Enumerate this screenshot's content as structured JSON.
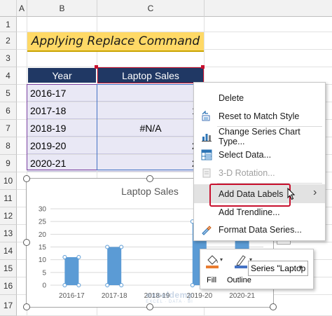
{
  "sheet": {
    "columns": [
      "A",
      "B",
      "C"
    ],
    "rows": [
      "1",
      "2",
      "3",
      "4",
      "5",
      "6",
      "7",
      "8",
      "9",
      "10",
      "11",
      "12",
      "13",
      "14",
      "15",
      "16",
      "17"
    ]
  },
  "banner": {
    "title": "Applying Replace Command"
  },
  "table": {
    "headers": [
      "Year",
      "Laptop Sales"
    ],
    "rows": [
      {
        "year": "2016-17",
        "sales": "",
        "tail": ""
      },
      {
        "year": "2017-18",
        "sales": "",
        "tail": "1"
      },
      {
        "year": "2018-19",
        "sales": "#N/A",
        "tail": ""
      },
      {
        "year": "2019-20",
        "sales": "",
        "tail": "2"
      },
      {
        "year": "2020-21",
        "sales": "",
        "tail": "2"
      }
    ]
  },
  "chart_data": {
    "type": "bar",
    "title": "Laptop Sales",
    "categories": [
      "2016-17",
      "2017-18",
      "2018-19",
      "2019-20",
      "2020-21"
    ],
    "values": [
      11,
      15,
      null,
      25,
      25
    ],
    "ylim": [
      0,
      30
    ],
    "yticks": [
      "30",
      "25",
      "20",
      "15",
      "10",
      "5",
      "0"
    ],
    "xlabel": "",
    "ylabel": "",
    "bar_color": "#5b9bd5",
    "grid": true
  },
  "context_menu": {
    "items": [
      {
        "label": "Delete",
        "icon": "none",
        "enabled": true
      },
      {
        "label": "Reset to Match Style",
        "icon": "reset-style-icon",
        "enabled": true
      },
      {
        "label": "Change Series Chart Type...",
        "icon": "chart-type-icon",
        "enabled": true
      },
      {
        "label": "Select Data...",
        "icon": "select-data-icon",
        "enabled": true
      },
      {
        "label": "3-D Rotation...",
        "icon": "rotation-icon",
        "enabled": false
      },
      {
        "label": "Add Data Labels",
        "icon": "none",
        "enabled": true,
        "submenu": true
      },
      {
        "label": "Add Trendline...",
        "icon": "none",
        "enabled": true
      },
      {
        "label": "Format Data Series...",
        "icon": "format-series-icon",
        "enabled": true
      }
    ],
    "submenu_arrow": "›",
    "highlight_color": "#c8102e"
  },
  "mini_toolbar": {
    "fill_label": "Fill",
    "outline_label": "Outline",
    "series_select": "Series \"Laptop"
  },
  "watermark": {
    "name": "exceldemy",
    "tagline": "EXCEL · DATA · BI"
  },
  "colors": {
    "header_bg": "#203864",
    "cell_bg": "#e9e8f5",
    "banner_bg": "#ffd966",
    "accent_red": "#c8102e"
  }
}
